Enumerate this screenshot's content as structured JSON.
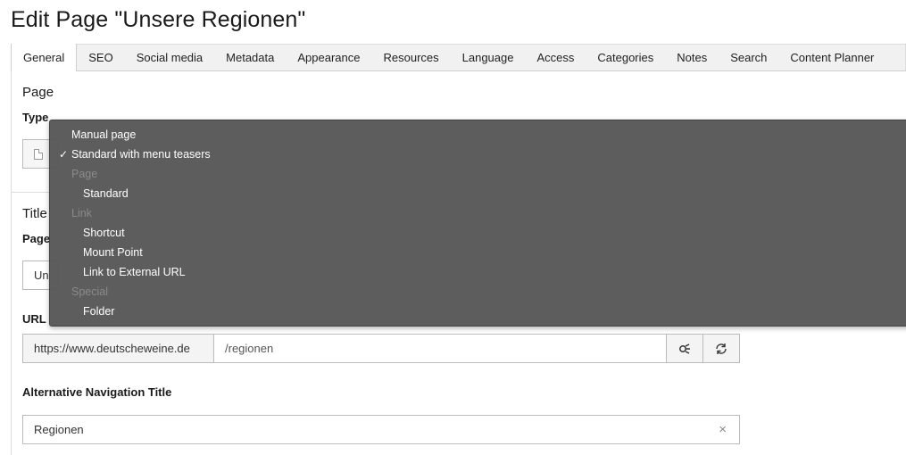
{
  "page": {
    "title": "Edit Page \"Unsere Regionen\""
  },
  "tabs": [
    {
      "label": "General",
      "active": true
    },
    {
      "label": "SEO"
    },
    {
      "label": "Social media"
    },
    {
      "label": "Metadata"
    },
    {
      "label": "Appearance"
    },
    {
      "label": "Resources"
    },
    {
      "label": "Language"
    },
    {
      "label": "Access"
    },
    {
      "label": "Categories"
    },
    {
      "label": "Notes"
    },
    {
      "label": "Search"
    },
    {
      "label": "Content Planner"
    }
  ],
  "sections": {
    "page": "Page",
    "type_label": "Type",
    "title_section": "Title",
    "page_title_label": "Page",
    "page_title_value": "Un",
    "url_label": "URL",
    "url_prefix": "https://www.deutscheweine.de",
    "url_path": "/regionen",
    "nav_title_label": "Alternative Navigation Title",
    "nav_title_value": "Regionen",
    "clear_glyph": "×"
  },
  "dropdown": {
    "checkmark": "✓",
    "items": [
      {
        "kind": "option",
        "label": "Manual page"
      },
      {
        "kind": "option",
        "label": "Standard with menu teasers",
        "selected": true
      },
      {
        "kind": "group",
        "label": "Page"
      },
      {
        "kind": "option",
        "label": "Standard",
        "indent": true
      },
      {
        "kind": "group",
        "label": "Link"
      },
      {
        "kind": "option",
        "label": "Shortcut",
        "indent": true
      },
      {
        "kind": "option",
        "label": "Mount Point",
        "indent": true
      },
      {
        "kind": "option",
        "label": "Link to External URL",
        "indent": true
      },
      {
        "kind": "group",
        "label": "Special"
      },
      {
        "kind": "option",
        "label": "Folder",
        "indent": true
      }
    ]
  }
}
